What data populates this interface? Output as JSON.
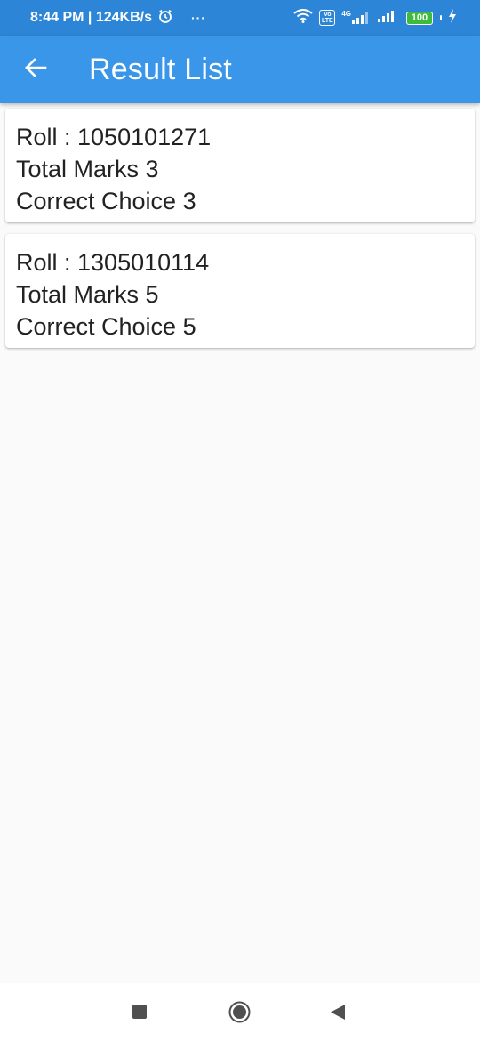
{
  "status_bar": {
    "time_speed": "8:44 PM | 124KB/s",
    "more": "···",
    "volte": "Vo\nLTE",
    "network": "4G",
    "battery": "100"
  },
  "app_bar": {
    "title": "Result List"
  },
  "results": [
    {
      "roll": "Roll : 1050101271",
      "total_marks": "Total Marks 3",
      "correct_choice": "Correct Choice 3"
    },
    {
      "roll": "Roll : 1305010114",
      "total_marks": "Total Marks 5",
      "correct_choice": "Correct Choice 5"
    }
  ],
  "colors": {
    "status_bar": "#2c85d6",
    "app_bar": "#3a96e8",
    "background": "#fafafa",
    "card": "#ffffff",
    "text": "#222222"
  },
  "icons": {
    "back": "arrow-left-icon",
    "alarm": "alarm-icon",
    "wifi": "wifi-icon",
    "signal": "signal-icon",
    "charging": "lightning-icon",
    "nav_recents": "square-icon",
    "nav_home": "circle-icon",
    "nav_back": "triangle-icon"
  }
}
